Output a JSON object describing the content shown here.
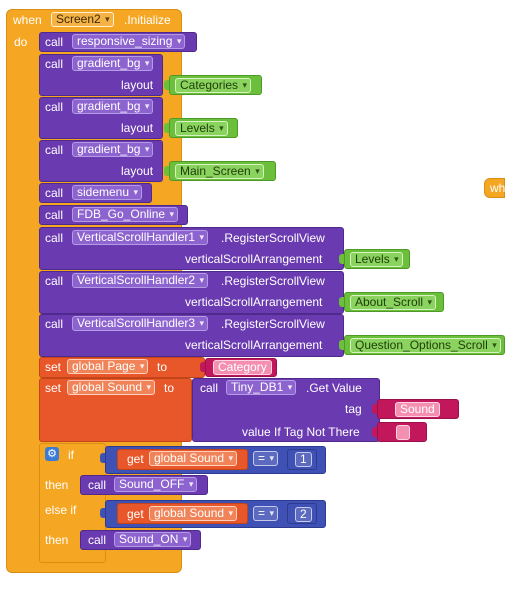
{
  "event": {
    "when_kw": "when",
    "component": "Screen2",
    "event_name": ".Initialize",
    "do_kw": "do"
  },
  "kw": {
    "call": "call",
    "set": "set",
    "to": "to",
    "get": "get",
    "if": "if",
    "then": "then",
    "else_if": "else if"
  },
  "calls": [
    {
      "proc": "responsive_sizing"
    },
    {
      "proc": "gradient_bg",
      "param": "layout",
      "value": "Categories"
    },
    {
      "proc": "gradient_bg",
      "param": "layout",
      "value": "Levels"
    },
    {
      "proc": "gradient_bg",
      "param": "layout",
      "value": "Main_Screen"
    },
    {
      "proc": "sidemenu"
    },
    {
      "proc": "FDB_Go_Online"
    },
    {
      "component": "VerticalScrollHandler1",
      "method": ".RegisterScrollView",
      "param": "verticalScrollArrangement",
      "value": "Levels"
    },
    {
      "component": "VerticalScrollHandler2",
      "method": ".RegisterScrollView",
      "param": "verticalScrollArrangement",
      "value": "About_Scroll"
    },
    {
      "component": "VerticalScrollHandler3",
      "method": ".RegisterScrollView",
      "param": "verticalScrollArrangement",
      "value": "Question_Options_Scroll"
    }
  ],
  "set_page": {
    "variable": "global Page",
    "value": "Category"
  },
  "set_sound": {
    "variable": "global Sound",
    "component": "Tiny_DB1",
    "method": ".Get Value",
    "tag_param": "tag",
    "tag_value": "Sound",
    "default_param": "value If Tag Not There",
    "default_value": ""
  },
  "if_block": {
    "cond1": {
      "variable": "global Sound",
      "op": "=",
      "number": "1"
    },
    "then1": "Sound_OFF",
    "cond2": {
      "variable": "global Sound",
      "op": "=",
      "number": "2"
    },
    "then2": "Sound_ON"
  },
  "offscreen_label": "wh",
  "colors": {
    "event": "#f5a623",
    "procedure": "#6a3ab1",
    "variable": "#e8572a",
    "text": "#c2185b",
    "component": "#6bbf3b",
    "math": "#3f51b5"
  }
}
